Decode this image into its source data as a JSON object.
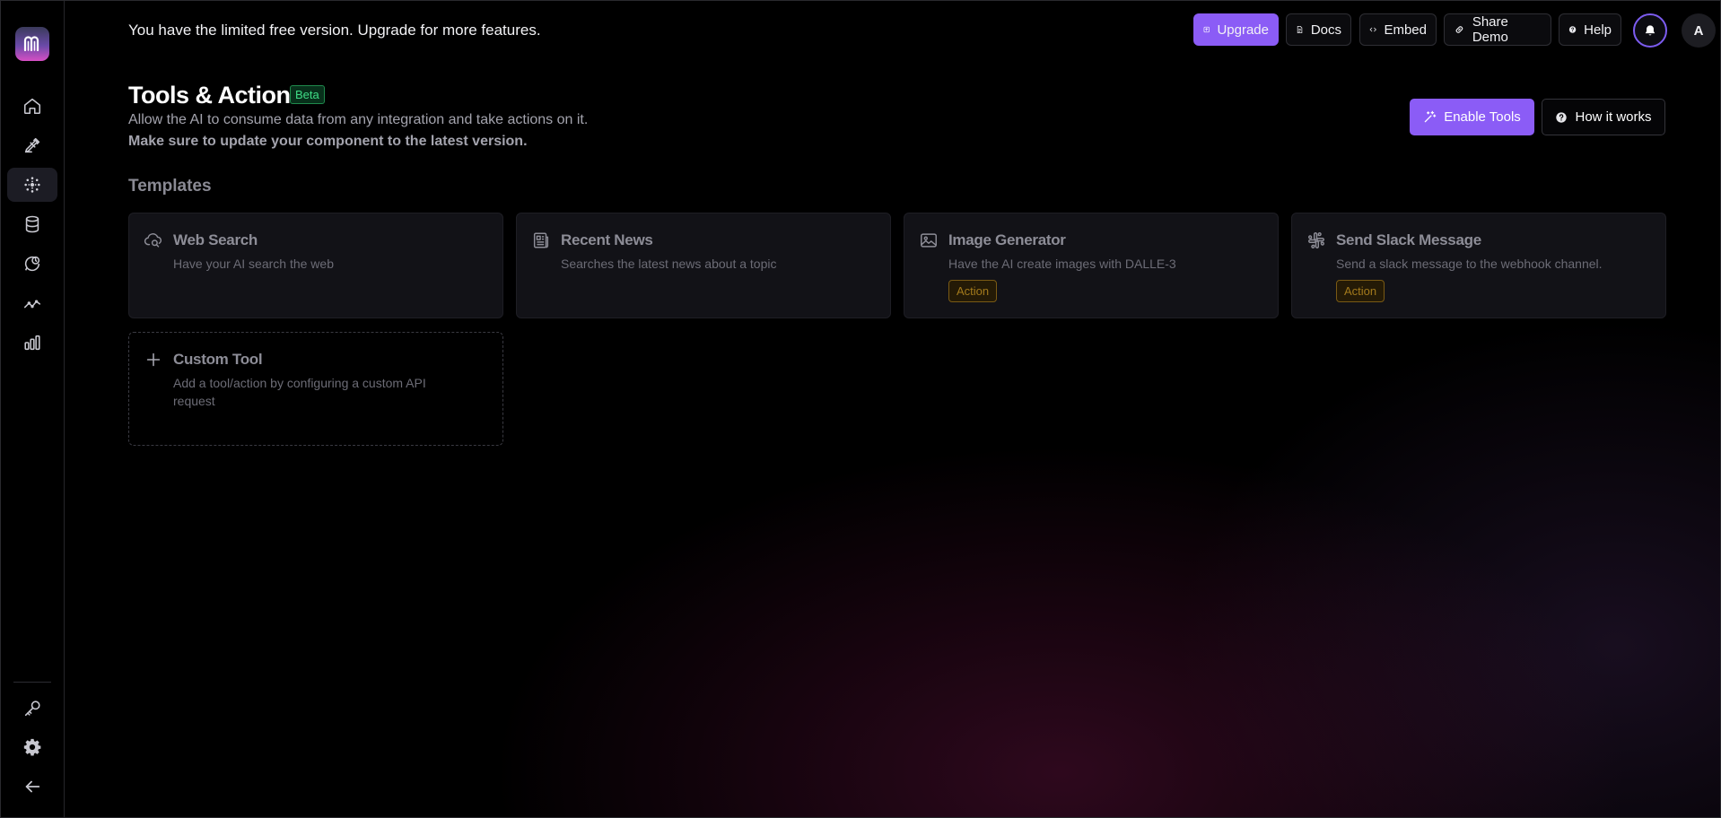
{
  "banner": {
    "text": "You have the limited free version. Upgrade for more features."
  },
  "topbar": {
    "upgrade": "Upgrade",
    "docs": "Docs",
    "embed": "Embed",
    "share_demo": "Share Demo",
    "help": "Help",
    "avatar_initial": "A"
  },
  "header": {
    "title": "Tools & Actions",
    "badge": "Beta",
    "subtitle1": "Allow the AI to consume data from any integration and take actions on it.",
    "subtitle2": "Make sure to update your component to the latest version.",
    "enable_tools": "Enable Tools",
    "how_it_works": "How it works"
  },
  "templates": {
    "section_title": "Templates",
    "cards": [
      {
        "title": "Web Search",
        "description": "Have your AI search the web",
        "icon": "cloud-search-icon"
      },
      {
        "title": "Recent News",
        "description": "Searches the latest news about a topic",
        "icon": "newspaper-icon"
      },
      {
        "title": "Image Generator",
        "description": "Have the AI create images with DALLE-3",
        "tag": "Action",
        "icon": "image-icon"
      },
      {
        "title": "Send Slack Message",
        "description": "Send a slack message to the webhook channel.",
        "tag": "Action",
        "icon": "slack-icon"
      }
    ],
    "custom": {
      "title": "Custom Tool",
      "description": "Add a tool/action by configuring a custom API request",
      "icon": "plus-icon"
    }
  },
  "colors": {
    "accent": "#8b5cf6",
    "beta_green": "#3fdc86",
    "action_amber": "#a37a1c"
  }
}
